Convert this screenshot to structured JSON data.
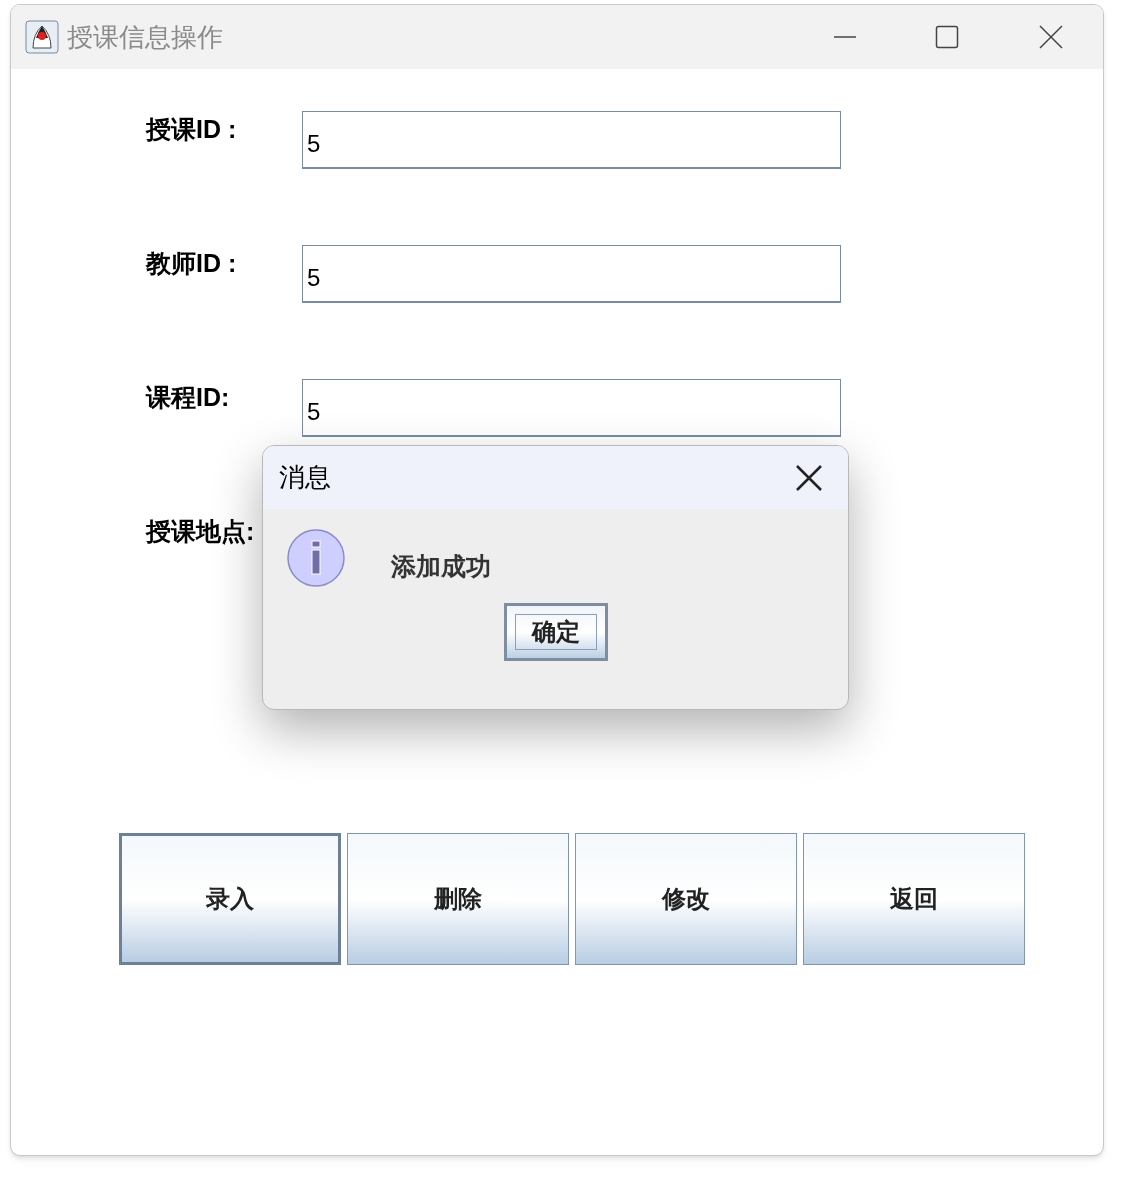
{
  "window": {
    "title": "授课信息操作"
  },
  "fields": [
    {
      "label": "授课ID :",
      "value": "5"
    },
    {
      "label": "教师ID :",
      "value": "5"
    },
    {
      "label": "课程ID:",
      "value": "5"
    },
    {
      "label": "授课地点:"
    }
  ],
  "buttons": [
    {
      "label": "录入",
      "focused": true
    },
    {
      "label": "删除",
      "focused": false
    },
    {
      "label": "修改",
      "focused": false
    },
    {
      "label": "返回",
      "focused": false
    }
  ],
  "dialog": {
    "title": "消息",
    "message": "添加成功",
    "button": {
      "label": "确定",
      "focused": true
    }
  }
}
